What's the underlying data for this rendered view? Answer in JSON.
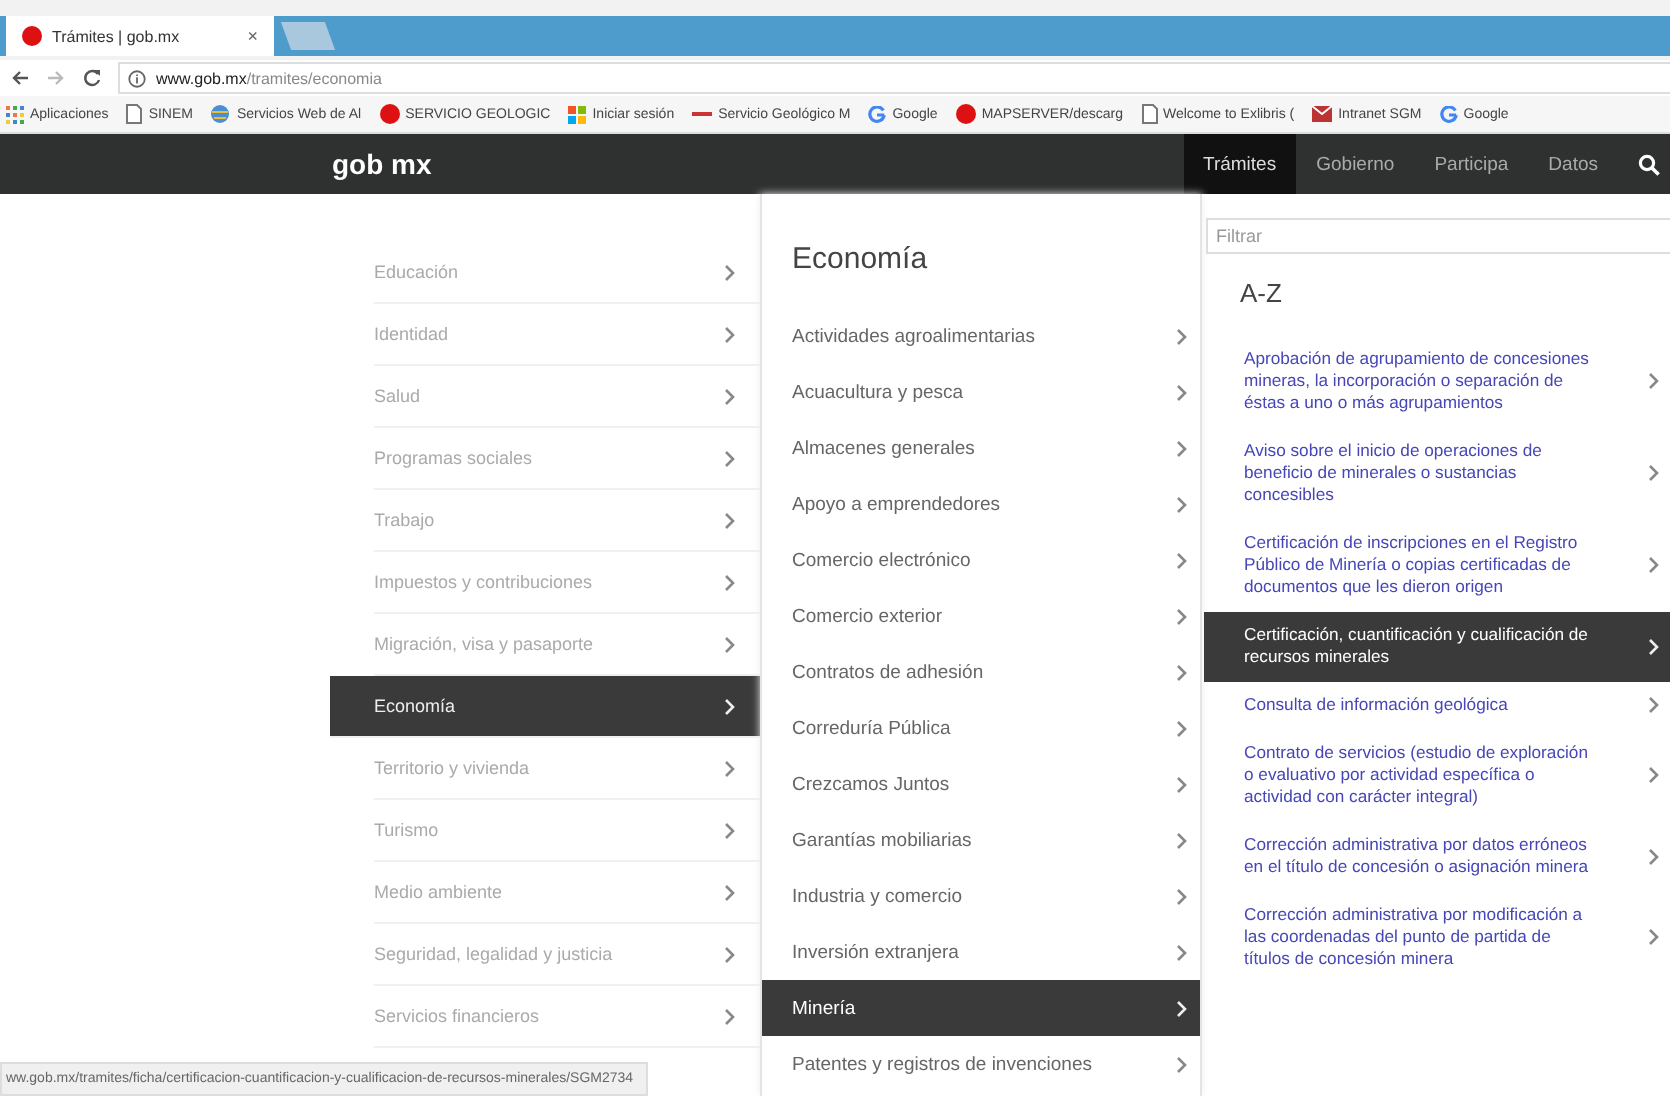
{
  "browser": {
    "tabs": [
      {
        "title": "Trámites | gob.mx",
        "selected": true,
        "close": "×"
      },
      {
        "kind": "new",
        "selected": false
      }
    ],
    "address": {
      "host": "www.gob.mx",
      "path": "/tramites/economia"
    },
    "bookmarks": [
      {
        "kind": "apps",
        "label": "Aplicaciones"
      },
      {
        "kind": "page",
        "label": "SINEM"
      },
      {
        "kind": "globe",
        "label": "Servicios Web de Al"
      },
      {
        "kind": "dot",
        "label": "SERVICIO GEOLOGIC"
      },
      {
        "kind": "windows",
        "label": "Iniciar sesión"
      },
      {
        "kind": "line",
        "label": "Servicio Geológico M"
      },
      {
        "kind": "google",
        "label": "Google"
      },
      {
        "kind": "dot",
        "label": "MAPSERVER/descarg"
      },
      {
        "kind": "page",
        "label": "Welcome to Exlibris ("
      },
      {
        "kind": "sgm",
        "label": "Intranet SGM"
      },
      {
        "kind": "google",
        "label": "Google"
      }
    ]
  },
  "site_nav": {
    "logo": "gob mx",
    "items": [
      {
        "label": "Trámites",
        "selected": true
      },
      {
        "label": "Gobierno",
        "selected": false
      },
      {
        "label": "Participa",
        "selected": false
      },
      {
        "label": "Datos",
        "selected": false
      }
    ]
  },
  "categories": [
    {
      "label": "Educación",
      "selected": false
    },
    {
      "label": "Identidad",
      "selected": false
    },
    {
      "label": "Salud",
      "selected": false
    },
    {
      "label": "Programas sociales",
      "selected": false
    },
    {
      "label": "Trabajo",
      "selected": false
    },
    {
      "label": "Impuestos y contribuciones",
      "selected": false
    },
    {
      "label": "Migración, visa y pasaporte",
      "selected": false
    },
    {
      "label": "Economía",
      "selected": true
    },
    {
      "label": "Territorio y vivienda",
      "selected": false
    },
    {
      "label": "Turismo",
      "selected": false
    },
    {
      "label": "Medio ambiente",
      "selected": false
    },
    {
      "label": "Seguridad, legalidad y justicia",
      "selected": false
    },
    {
      "label": "Servicios financieros",
      "selected": false
    }
  ],
  "subcategories": {
    "title": "Economía",
    "items": [
      {
        "label": "Actividades agroalimentarias",
        "selected": false
      },
      {
        "label": "Acuacultura y pesca",
        "selected": false
      },
      {
        "label": "Almacenes generales",
        "selected": false
      },
      {
        "label": "Apoyo a emprendedores",
        "selected": false
      },
      {
        "label": "Comercio electrónico",
        "selected": false
      },
      {
        "label": "Comercio exterior",
        "selected": false
      },
      {
        "label": "Contratos de adhesión",
        "selected": false
      },
      {
        "label": "Correduría Pública",
        "selected": false
      },
      {
        "label": "Crezcamos Juntos",
        "selected": false
      },
      {
        "label": "Garantías mobiliarias",
        "selected": false
      },
      {
        "label": "Industria y comercio",
        "selected": false
      },
      {
        "label": "Inversión extranjera",
        "selected": false
      },
      {
        "label": "Minería",
        "selected": true
      },
      {
        "label": "Patentes y registros de invenciones",
        "selected": false
      }
    ]
  },
  "procedures": {
    "filter": {
      "placeholder": "Filtrar"
    },
    "title": "A-Z",
    "items": [
      {
        "label": "Aprobación de agrupamiento de concesiones mineras, la incorporación o separación de éstas a uno o más agrupamientos",
        "selected": false
      },
      {
        "label": "Aviso sobre el inicio de operaciones de beneficio de minerales o sustancias concesibles",
        "selected": false
      },
      {
        "label": "Certificación de inscripciones en el Registro Público de Minería o copias certificadas de documentos que les dieron origen",
        "selected": false
      },
      {
        "label": "Certificación, cuantificación y cualificación de recursos minerales",
        "selected": true
      },
      {
        "label": "Consulta de información geológica",
        "selected": false
      },
      {
        "label": "Contrato de servicios (estudio de exploración o evaluativo por actividad específica o actividad con carácter integral)",
        "selected": false
      },
      {
        "label": "Corrección administrativa por datos erróneos en el título de concesión o asignación minera",
        "selected": false
      },
      {
        "label": "Corrección administrativa por modificación a las coordenadas del punto de partida de títulos de concesión minera",
        "selected": false
      }
    ]
  },
  "status_bar": "ww.gob.mx/tramites/ficha/certificacion-cuantificacion-y-cualificacion-de-recursos-minerales/SGM2734"
}
